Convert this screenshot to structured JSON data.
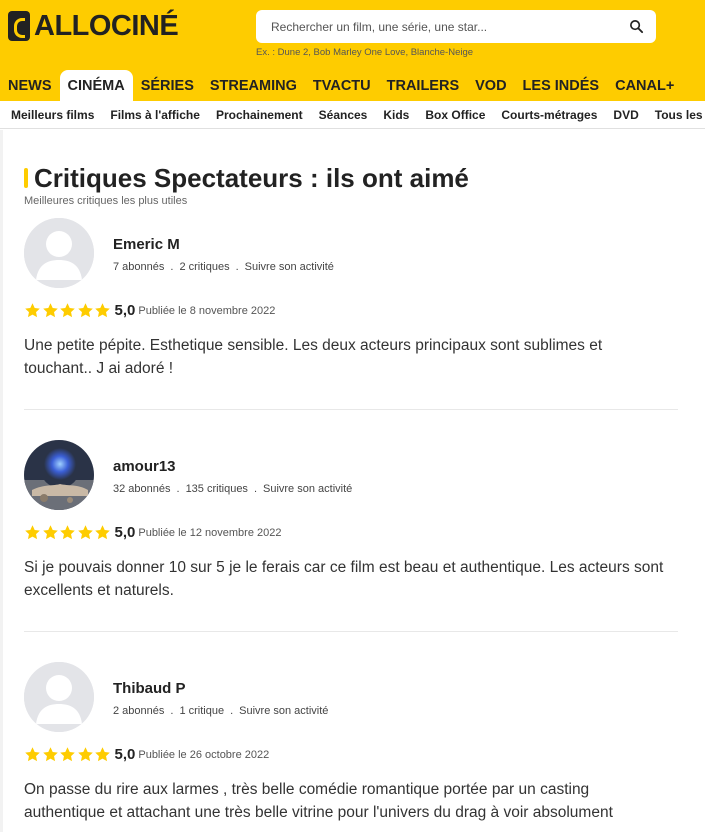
{
  "header": {
    "logo_text": "ALLOCINÉ",
    "search_placeholder": "Rechercher un film, une série, une star...",
    "search_hint": "Ex. : Dune 2, Bob Marley One Love, Blanche-Neige",
    "brand_color": "#fecc00"
  },
  "main_nav": [
    {
      "label": "NEWS",
      "active": false
    },
    {
      "label": "CINÉMA",
      "active": true
    },
    {
      "label": "SÉRIES",
      "active": false
    },
    {
      "label": "STREAMING",
      "active": false
    },
    {
      "label": "TVACTU",
      "active": false
    },
    {
      "label": "TRAILERS",
      "active": false
    },
    {
      "label": "VOD",
      "active": false
    },
    {
      "label": "LES INDÉS",
      "active": false
    },
    {
      "label": "CANAL+",
      "active": false
    }
  ],
  "sub_nav": [
    "Meilleurs films",
    "Films à l'affiche",
    "Prochainement",
    "Séances",
    "Kids",
    "Box Office",
    "Courts-métrages",
    "DVD",
    "Tous les"
  ],
  "section": {
    "title": "Critiques Spectateurs : ils ont aimé",
    "subtitle": "Meilleures critiques les plus utiles"
  },
  "reviews": [
    {
      "name": "Emeric M",
      "followers": "7 abonnés",
      "critiques": "2 critiques",
      "follow": "Suivre son activité",
      "rating": "5,0",
      "stars": 5,
      "published": "Publiée le 8 novembre 2022",
      "text": "Une petite pépite. Esthetique sensible. Les deux acteurs principaux sont sublimes et touchant.. J ai adoré !",
      "avatar": "default-avatar-icon"
    },
    {
      "name": "amour13",
      "followers": "32 abonnés",
      "critiques": "135 critiques",
      "follow": "Suivre son activité",
      "rating": "5,0",
      "stars": 5,
      "published": "Publiée le 12 novembre 2022",
      "text": "Si je pouvais donner 10 sur 5 je le ferais car ce film est beau et authentique. Les acteurs sont excellents et naturels.",
      "avatar": "photo-avatar"
    },
    {
      "name": "Thibaud P",
      "followers": "2 abonnés",
      "critiques": "1 critique",
      "follow": "Suivre son activité",
      "rating": "5,0",
      "stars": 5,
      "published": "Publiée le 26 octobre 2022",
      "text": "On passe du rire aux larmes , très belle comédie romantique portée par un casting authentique et attachant une très belle vitrine pour l'univers du drag à voir absolument",
      "avatar": "default-avatar-icon"
    }
  ]
}
